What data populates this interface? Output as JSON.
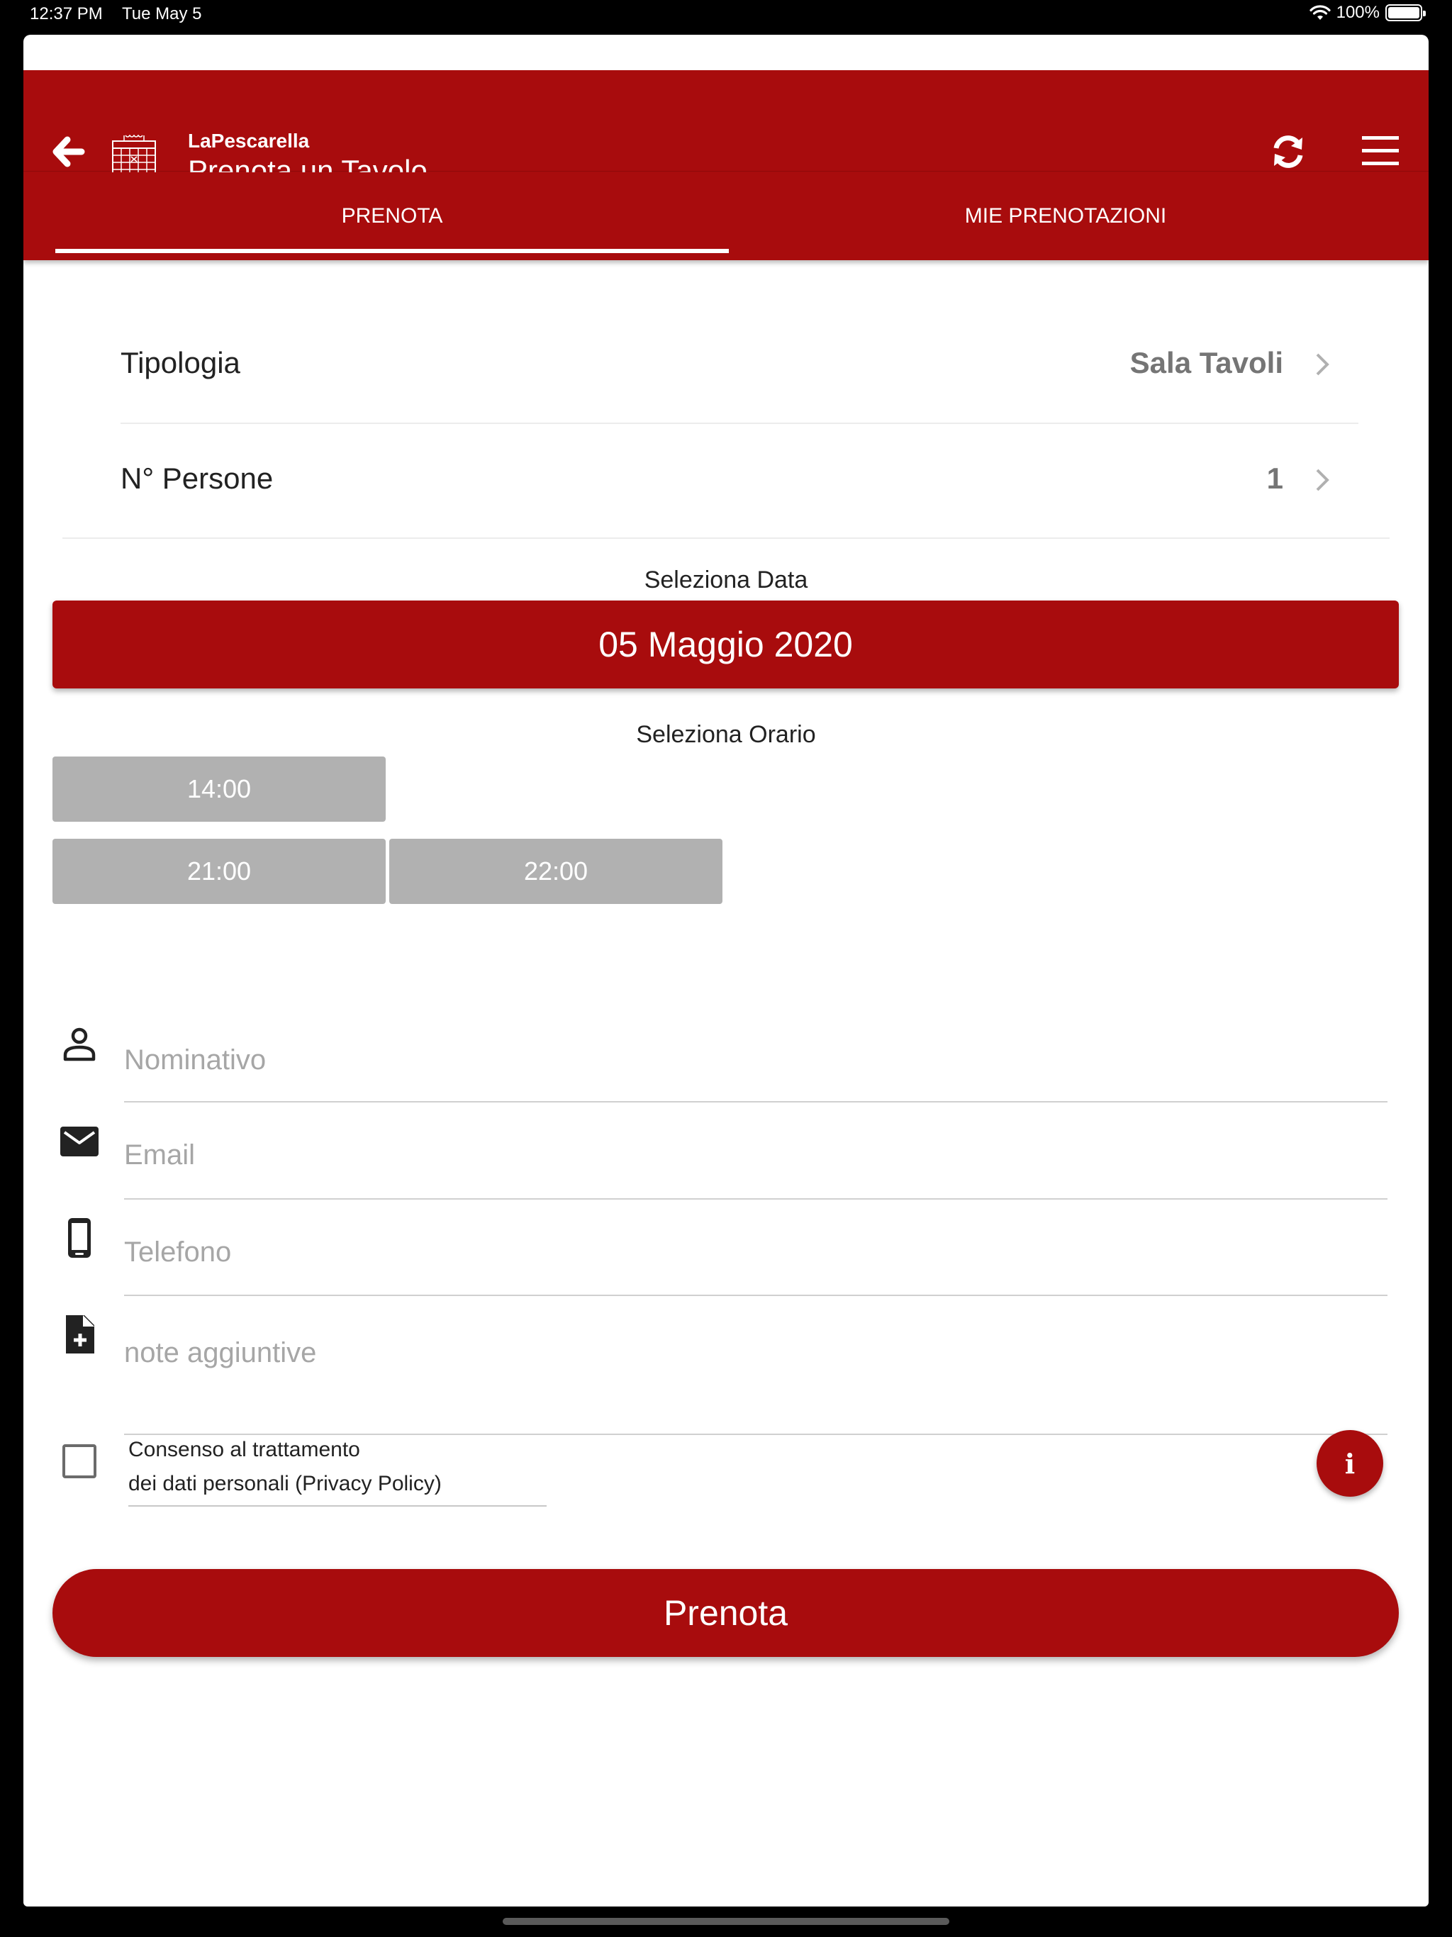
{
  "status_bar": {
    "time": "12:37 PM",
    "date": "Tue May 5",
    "battery": "100%"
  },
  "header": {
    "brand": "LaPescarella",
    "title": "Prenota un Tavolo"
  },
  "tabs": [
    {
      "label": "PRENOTA",
      "active": true
    },
    {
      "label": "MIE PRENOTAZIONI",
      "active": false
    }
  ],
  "options": {
    "tipologia": {
      "label": "Tipologia",
      "value": "Sala Tavoli"
    },
    "persone": {
      "label": "N° Persone",
      "value": "1"
    }
  },
  "date": {
    "label": "Seleziona Data",
    "value": "05 Maggio 2020"
  },
  "time": {
    "label": "Seleziona Orario",
    "slots": [
      "14:00",
      "21:00",
      "22:00"
    ]
  },
  "form": {
    "name_placeholder": "Nominativo",
    "email_placeholder": "Email",
    "phone_placeholder": "Telefono",
    "notes_placeholder": "note aggiuntive"
  },
  "consent": {
    "line1": "Consenso al trattamento",
    "line2": "dei dati personali (Privacy Policy)",
    "checked": false
  },
  "info_label": "i",
  "submit_label": "Prenota",
  "colors": {
    "primary": "#a80c0d",
    "slot_bg": "#b1b1b1",
    "value_gray": "#757575"
  },
  "icons": [
    "back-arrow-icon",
    "calendar-icon",
    "refresh-icon",
    "menu-icon",
    "chevron-right-icon",
    "person-icon",
    "mail-icon",
    "phone-icon",
    "note-add-icon",
    "info-icon",
    "wifi-icon",
    "battery-icon"
  ]
}
